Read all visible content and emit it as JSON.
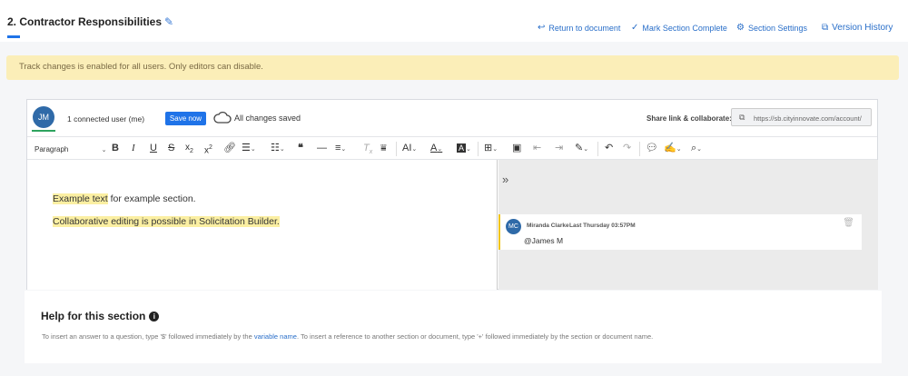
{
  "header": {
    "title": "2. Contractor Responsibilities",
    "actions": {
      "return": "Return to document",
      "mark_complete": "Mark Section Complete",
      "settings": "Section Settings",
      "history": "Version History"
    }
  },
  "banner": {
    "text": "Track changes is enabled for all users. Only editors can disable."
  },
  "collab": {
    "user_initials": "JM",
    "connected": "1 connected user (me)",
    "save_label": "Save now",
    "status": "All changes saved",
    "share_label": "Share link & collaborate:",
    "share_url": "https://sb.cityinnovate.com/account/"
  },
  "toolbar": {
    "paragraph": "Paragraph",
    "bold": "B",
    "italic": "I",
    "underline": "U",
    "strike": "S",
    "quote": "❝",
    "font_size": "AI",
    "font_color": "A",
    "bg_color": "A"
  },
  "editor": {
    "para1_hl": "Example text",
    "para1_rest": " for example section.",
    "para2": "Collaborative editing is possible in Solicitation Builder."
  },
  "comments": [
    {
      "initials": "MC",
      "author": "Miranda Clarke",
      "date": "Last Thursday 03:57PM",
      "text": "@James M"
    }
  ],
  "help": {
    "title": "Help for this section",
    "text_before": "To insert an answer to a question, type '$' followed immediately by the ",
    "link": "variable name",
    "text_after": ". To insert a reference to another section or document, type '+' followed immediately by the section or document name."
  },
  "colors": {
    "accent": "#1f73e8",
    "banner": "#fbeeb8",
    "highlight": "#fbefa2"
  }
}
